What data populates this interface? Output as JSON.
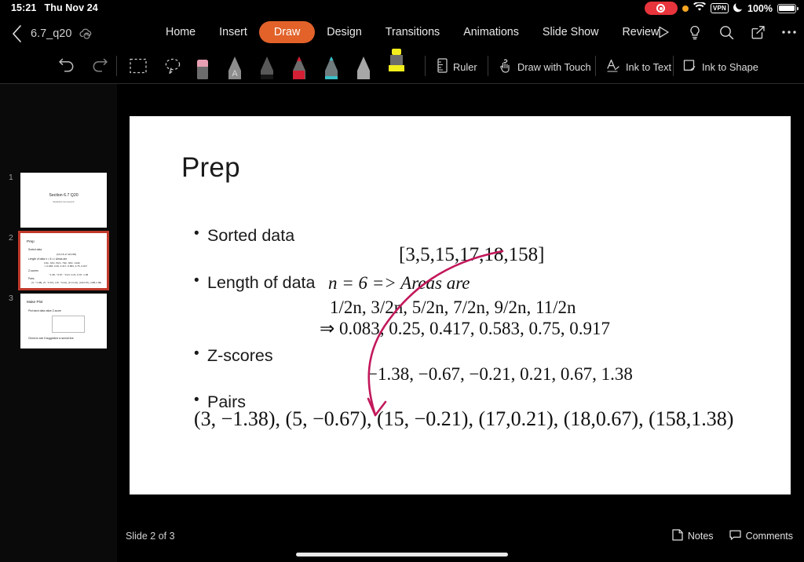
{
  "status_bar": {
    "time": "15:21",
    "date": "Thu Nov 24",
    "battery_percent": "100%",
    "vpn_label": "VPN",
    "icons": [
      "screen-recording-pill",
      "orange-privacy-dot",
      "wifi-icon",
      "vpn-badge",
      "do-not-disturb-moon-icon",
      "battery-icon"
    ]
  },
  "titlebar": {
    "back_label": "back-chevron",
    "filename": "6.7_q20",
    "cloud_status_icon": "cloud-sync-icon",
    "right_icons": [
      "present-play-icon",
      "tell-me-lightbulb-icon",
      "search-icon",
      "share-icon",
      "more-ellipsis-icon"
    ]
  },
  "ribbon": {
    "tabs": [
      {
        "label": "Home",
        "active": false
      },
      {
        "label": "Insert",
        "active": false
      },
      {
        "label": "Draw",
        "active": true
      },
      {
        "label": "Design",
        "active": false
      },
      {
        "label": "Transitions",
        "active": false
      },
      {
        "label": "Animations",
        "active": false
      },
      {
        "label": "Slide Show",
        "active": false
      },
      {
        "label": "Review",
        "active": false
      }
    ],
    "active_tab": "Draw",
    "active_tab_color": "#e2622a"
  },
  "draw_toolbar": {
    "undo_label": "Undo",
    "redo_label": "Redo",
    "select_label": "Select",
    "lasso_label": "Lasso Select",
    "tools": [
      {
        "name": "eraser",
        "color": "#e8a0b4",
        "selected": false
      },
      {
        "name": "pen-a",
        "color": "#8d8d8d",
        "selected": false
      },
      {
        "name": "pen-black",
        "color": "#2b2b2b",
        "selected": false
      },
      {
        "name": "pen-red",
        "color": "#d41f34",
        "selected": false
      },
      {
        "name": "pen-teal",
        "color": "#39c0c8",
        "selected": false
      },
      {
        "name": "pencil-gray",
        "color": "#a7a7a7",
        "selected": false
      },
      {
        "name": "highlighter-yellow",
        "color": "#f2ee1d",
        "selected": true
      }
    ],
    "commands": [
      {
        "label": "Ruler",
        "icon": "ruler-icon"
      },
      {
        "label": "Draw with Touch",
        "icon": "hand-draw-icon"
      },
      {
        "label": "Ink to Text",
        "icon": "ink-to-text-icon"
      },
      {
        "label": "Ink to Shape",
        "icon": "ink-to-shape-icon"
      }
    ]
  },
  "navigator": {
    "slides": [
      {
        "number": "1",
        "selected": false,
        "title": "Section 6.7 Q20",
        "subtitle": "Statistics Homework"
      },
      {
        "number": "2",
        "selected": true,
        "title": "Prep",
        "lines": [
          "Sorted data",
          "[3,5,15,17,18,158]",
          "Length of data n = 6 => Areas are",
          "1/2n, 3/2n, 5/2n, 7/2n, 9/2n, 11/2n",
          "⇒ 0.083, 0.25, 0.417, 0.583, 0.75, 0.917",
          "Z-scores",
          "−1.38, −0.67, −0.21, 0.21, 0.67, 1.38",
          "Pairs",
          "(3, −1.38), (5, −0.67), (15, −0.21), (17,0.21), (18,0.67), (158,1.38)"
        ]
      },
      {
        "number": "3",
        "selected": false,
        "title": "Make Plot",
        "lines": [
          "Plot each data value Z-score",
          "Check to see if suggested a normal line"
        ]
      }
    ]
  },
  "slide": {
    "title": "Prep",
    "bullets": [
      {
        "text": "Sorted data"
      },
      {
        "text": "Length of data "
      },
      {
        "text": "Z-scores"
      },
      {
        "text": "Pairs"
      }
    ],
    "bullet2_math": "n = 6 => Areas are",
    "data_array": "[3,5,15,17,18,158]",
    "areas_fractions": "1/2n, 3/2n, 5/2n, 7/2n, 9/2n, 11/2n",
    "areas_decimals": "⇒ 0.083, 0.25, 0.417, 0.583, 0.75, 0.917",
    "zscores": "−1.38, −0.67, −0.21, 0.21, 0.67, 1.38",
    "pairs": "(3, −1.38), (5, −0.67), (15, −0.21), (17,0.21), (18,0.67), (158,1.38)",
    "ink_annotation": {
      "type": "curved-arrow",
      "color": "#c2185b"
    }
  },
  "bottom_bar": {
    "slide_counter": "Slide 2 of 3",
    "notes_label": "Notes",
    "comments_label": "Comments"
  }
}
